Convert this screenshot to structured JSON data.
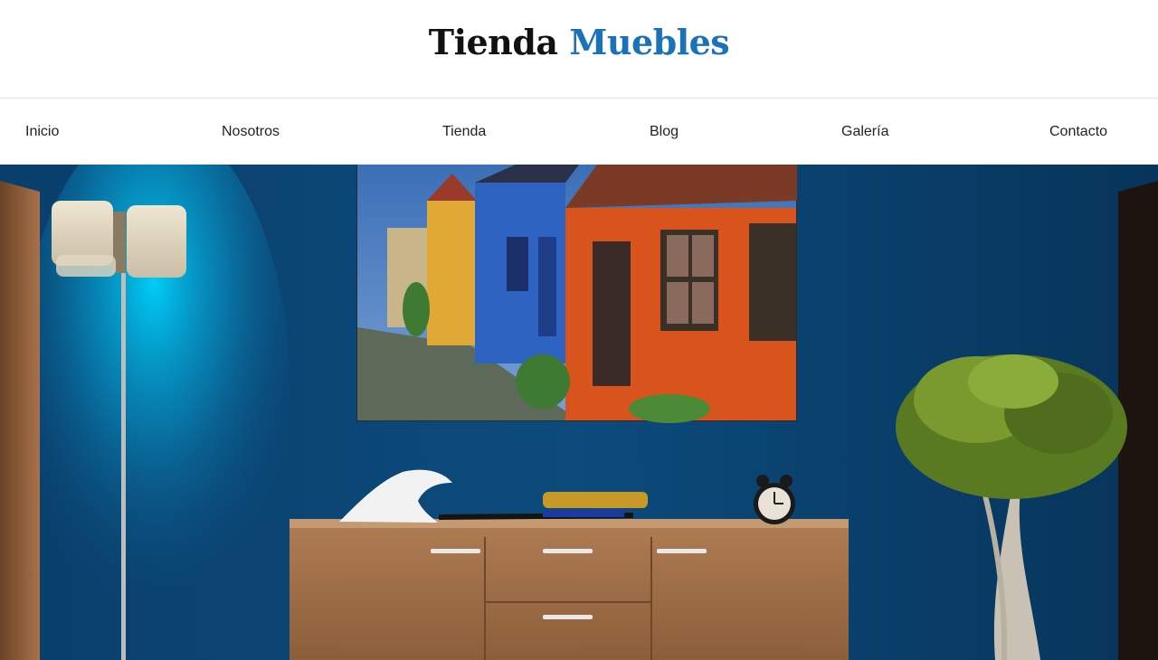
{
  "header": {
    "logo_part1": "Tienda",
    "logo_part2": "Muebles",
    "logo_color_dark": "#111111",
    "logo_color_accent": "#1a73b8"
  },
  "nav": {
    "items": [
      {
        "label": "Inicio"
      },
      {
        "label": "Nosotros"
      },
      {
        "label": "Tienda"
      },
      {
        "label": "Blog"
      },
      {
        "label": "Galería"
      },
      {
        "label": "Contacto"
      }
    ]
  },
  "hero": {
    "wall_color": "#0b4a7a",
    "lamp_glow_color": "#00c8f0",
    "furniture_color": "#a0704a"
  }
}
